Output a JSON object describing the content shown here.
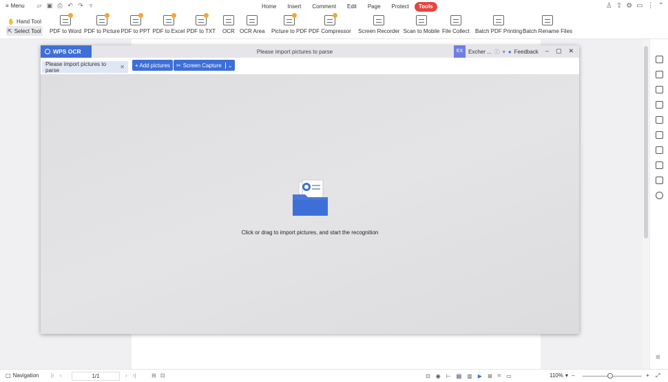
{
  "topbar": {
    "menu_label": "Menu",
    "tabs": [
      "Home",
      "Insert",
      "Comment",
      "Edit",
      "Page",
      "Protect",
      "Tools"
    ],
    "active_tab": "Tools"
  },
  "ribbon": {
    "hand_tool": "Hand Tool",
    "select_tool": "Select Tool",
    "items": [
      {
        "label": "PDF to Word",
        "premium": true
      },
      {
        "label": "PDF to Picture",
        "premium": true
      },
      {
        "label": "PDF to PPT",
        "premium": true
      },
      {
        "label": "PDF to Excel",
        "premium": true
      },
      {
        "label": "PDF to TXT",
        "premium": true
      },
      {
        "label": "OCR",
        "premium": false
      },
      {
        "label": "OCR Area",
        "premium": false
      },
      {
        "label": "Picture to PDF",
        "premium": true
      },
      {
        "label": "PDF Compressor",
        "premium": true
      },
      {
        "label": "Screen Recorder",
        "premium": false
      },
      {
        "label": "Scan to Mobile",
        "premium": false
      },
      {
        "label": "File Collect",
        "premium": false
      },
      {
        "label": "Batch PDF Printing",
        "premium": false
      },
      {
        "label": "Batch Rename Files",
        "premium": false
      }
    ]
  },
  "ocr_window": {
    "logo": "WPS OCR",
    "title": "Please import pictures to parse",
    "user_avatar": "EX",
    "user_name": "Excher ...",
    "feedback": "Feedback",
    "tab_label": "Please import pictures to parse",
    "add_pictures": "+ Add pictures",
    "screen_capture": "Screen Capture",
    "hint": "Click or drag to import pictures, and start the recognition"
  },
  "statusbar": {
    "navigation": "Navigation",
    "page": "1/1",
    "zoom": "110%"
  },
  "colors": {
    "accent": "#3d6fd8",
    "tools_tab": "#e8433d",
    "premium_badge": "#f7a531"
  }
}
